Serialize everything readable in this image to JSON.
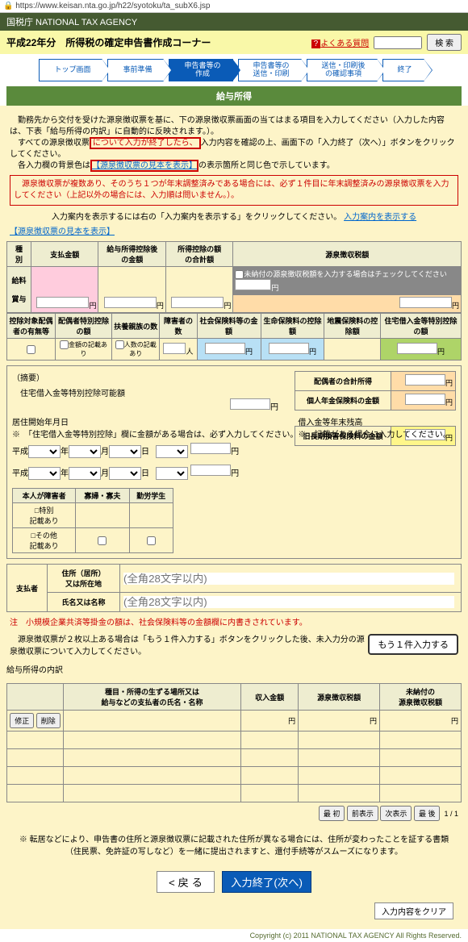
{
  "url": "https://www.keisan.nta.go.jp/h22/syotoku/ta_subX6.jsp",
  "agency": "国税庁  NATIONAL TAX AGENCY",
  "title": "平成22年分　所得税の確定申告書作成コーナー",
  "faq": "よくある質問",
  "search": "検 索",
  "nav": [
    "トップ画面",
    "事前準備",
    "申告書等の\n作成",
    "申告書等の\n送信・印刷",
    "送信・印刷後\nの確認事項",
    "終了"
  ],
  "section": "給与所得",
  "intro": {
    "p1": "　勤務先から交付を受けた源泉徴収票を基に、下の源泉徴収票画面の当てはまる項目を入力してください（入力した内容は、下表「給与所得の内訳」に自動的に反映されます。）。",
    "p2a": "　すべての源泉徴収票",
    "p2red": "について入力が終了したら、",
    "p2b": "入力内容を確認の上、画面下の「入力終了（次へ）」ボタンをクリックしてください。",
    "p3a": "　各入力欄の背景色は",
    "p3link": "【源泉徴収票の見本を表示】",
    "p3b": "の表示箇所と同じ色で示しています。",
    "warn": "　源泉徴収票が複数あり、そのうち１つが年末調整済みである場合には、必ず１件目に年末調整済みの源泉徴収票を入力してください（上記以外の場合には、入力順は問いません。）。",
    "p4": "入力案内を表示するには右の「入力案内を表示する」をクリックしてください。",
    "p4link": "入力案内を表示する",
    "p5link": "【源泉徴収票の見本を表示】"
  },
  "t1": {
    "h": [
      "種\n別",
      "支払金額",
      "給与所得控除後\nの金額",
      "所得控除の額\nの合計額",
      "源泉徴収税額"
    ],
    "r": [
      "給料\n\n賞与"
    ],
    "note": "未納付の源泉徴収税額を入力する場合はチェックしてください"
  },
  "t2": {
    "h": [
      "控除対象配偶者の有無等",
      "配偶者特別控除の額",
      "扶養親族の数",
      "障害者の数",
      "社会保険料等の金額",
      "生命保険料の控除額",
      "地震保険料の控除額",
      "住宅借入金等特別控除の額"
    ],
    "a": "金額の記載あり",
    "b": "人数の記載あり"
  },
  "ded": {
    "bracket": "（摘要）",
    "l1": "住宅借入金等特別控除可能額",
    "l2": "居住開始年月日\n※　「住宅借入金等特別控除」欄に金額がある場合は、必ず入力してください。",
    "l3": "借入金等年末残高\n※　記載がある場合に入力してください。",
    "heisei": "平成",
    "nen": "年",
    "tsuki": "月",
    "hi": "日",
    "box": "本人が障害者",
    "h1": "寡婦・寡夫",
    "h2": "勤労学生",
    "chk1": "□特別\n記載あり",
    "chk2": "□その他\n記載あり",
    "r1": "配偶者の合計所得",
    "r2": "個人年金保険料の金額",
    "r3": "旧長期損害保険料の金額"
  },
  "payer": {
    "l": "支払者",
    "r1": "住所（居所）\n又は所在地",
    "r2": "氏名又は名称",
    "ph": "(全角28文字以内)"
  },
  "note1": "注　小規模企業共済等掛金の額は、社会保険料等の金額欄に内書きされています。",
  "note2": "　源泉徴収票が２枚以上ある場合は「もう１件入力する」ボタンをクリックした後、未入力分の源泉徴収票について入力してください。",
  "add": "もう１件入力する",
  "brkdn": {
    "title": "給与所得の内訳",
    "h": [
      "",
      "種目・所得の生ずる場所又は\n給与などの支払者の氏名・名称",
      "収入金額",
      "源泉徴収税額",
      "未納付の\n源泉徴収税額"
    ],
    "b1": "修正",
    "b2": "削除"
  },
  "navbtns": [
    "最 初",
    "前表示",
    "次表示",
    "最 後"
  ],
  "page": "1 / 1",
  "foot": "※ 転居などにより、申告書の住所と源泉徴収票に記載された住所が異なる場合には、住所が変わったことを証する書類（住民票、免許証の写しなど）を一緒に提出されますと、還付手続等がスムーズになります。",
  "back": "< 戻 る",
  "next": "入力終了(次へ)",
  "clear": "入力内容をクリア",
  "copy": "Copyright (c) 2011 NATIONAL TAX AGENCY All Rights Reserved."
}
